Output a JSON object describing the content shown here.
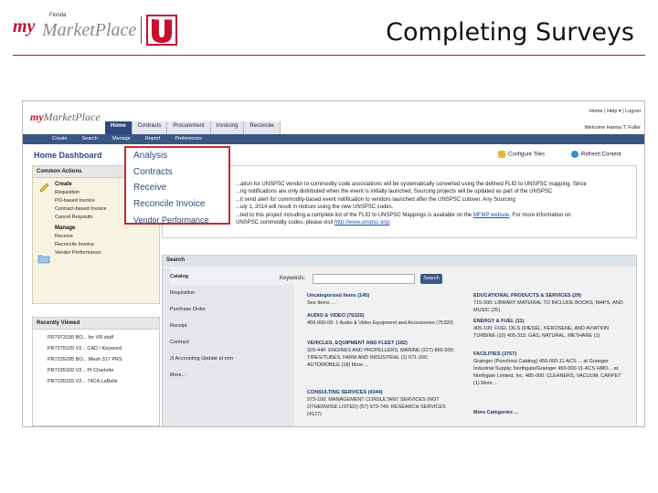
{
  "slide": {
    "title": "Completing Surveys",
    "logo": {
      "my": "my",
      "marketplace": "MarketPlace",
      "florida": "Florida"
    }
  },
  "app": {
    "logo": {
      "my": "my",
      "marketplace": "MarketPlace"
    },
    "main_tabs": [
      "Home",
      "Contracts",
      "Procurement",
      "Invoicing",
      "Reconcile"
    ],
    "active_tab": "Home",
    "top_links": "Home | Help ▾ | Logout",
    "welcome": "Welcome Hanna T. Fuller",
    "subnav": [
      "Create",
      "Search",
      "Manage",
      "Report",
      "Preferences"
    ],
    "dashboard_title": "Home Dashboard",
    "configure_tiles": "Configure Tiles",
    "refresh_content": "Refresh Content",
    "common_actions": {
      "header": "Common Actions",
      "create_label": "Create",
      "create_items": [
        "Requisition",
        "PO-based Invoice",
        "Contract-based Invoice",
        "Cancel Requisitn"
      ],
      "manage_label": "Manage",
      "manage_items": [
        "Receive",
        "Reconcile Invoice",
        "Vendor Performance"
      ]
    },
    "recently_viewed": {
      "header": "Recently Viewed",
      "items": [
        "PR7973195 BO... for VR stuff",
        "PR7275105 V2... CAD / Keyword",
        "PR7235295 BO... Mesh 317 PRS",
        "PR7235320 V2... Pt Charlotte",
        "PR7235155 V2... 74CA LaBelle"
      ]
    },
    "info": {
      "line1": "...ation for UNSPSC vendor to commodity code associations will be systematically converted using the defined FLID to UNSPSC mapping. Since",
      "line2": "...ng notifications are only distributed when the event is initially launched, Sourcing projects will be updated as part of the UNSPSC",
      "line3": "...ll send alert for commodity-based event notification to vendors launched after the UNSPSC cutover. Any Sourcing",
      "line4": "...uly 1, 2014 will result in notices using the new UNSPSC codes.",
      "line5a": "...ted to this project including a complete list of the FLID to UNSPSC Mappings is available on the ",
      "link1": "MFMP website",
      "line5b": ". For more information on",
      "line6a": "UNSPSC commodity codes, please visit ",
      "link2": "http://www.unspsc.org/",
      "line6b": "."
    },
    "search": {
      "header": "Search",
      "side": [
        "Catalog",
        "Requisition",
        "Purchase Order",
        "Receipt",
        "Contract",
        "JI Accounting Update at erm",
        "More..."
      ],
      "keywords_label": "Keywords:",
      "search_button": "Search",
      "col1": [
        {
          "head": "Uncategorized Items (145)",
          "text": "See Items ..."
        },
        {
          "head": "AUDIO & VIDEO (75320)",
          "text": "450-000-09: 1 Audio & Video Equipment and Accessories (75320)"
        },
        {
          "head": "VEHICLES, EQUIPMENT AND FLEET (182)",
          "text": "320-440: ENGINES AND PROPELLERS, MARINE (227) 865-000: TIRES/TUBES, FARM AND INDUSTRIAL (1) 071-200: AUTOMOBILE (18) More ..."
        },
        {
          "head": "CONSULTING SERVICES (4344)",
          "text": "973-100: MANAGEMENT CONSULTANT SERVICES (NOT OTHERWISE LISTED) (57) 973-740: RESEARCH SERVICES (4127)"
        }
      ],
      "col2": [
        {
          "head": "EDUCATIONAL PRODUCTS & SERVICES (29)",
          "text": "715-000: LIBRARY MATERIAL TO INCLUDE BOOKS, MAPS, AND MUSIC (25)"
        },
        {
          "head": "ENERGY & FUEL (11)",
          "text": "405-100: FUEL OILS (DIESEL, KEROSENE, AND AVIATION TURBINE (10) 405-315: GAS, NATURAL, METHANE (1)"
        },
        {
          "head": "FACILITIES (3767)",
          "text": "Grainger (Punchout Catalog) 450-000-11-ACS ... at Grainger Industrial Supply; Northgate/Grainger 450-000-11-ACS HMO... at Northgate Limited, Inc. 485-000: CLEANERS, VACUUM, CARPET (1) More ..."
        },
        {
          "head": "More Categories ...",
          "text": ""
        }
      ]
    },
    "highlight_menu": [
      "Analysis",
      "Contracts",
      "Receive",
      "Reconcile Invoice",
      "Vendor Performance"
    ]
  },
  "colors": {
    "accent": "#c8102e",
    "nav": "#2d4a7c",
    "highlight_border": "#c62b2b"
  }
}
